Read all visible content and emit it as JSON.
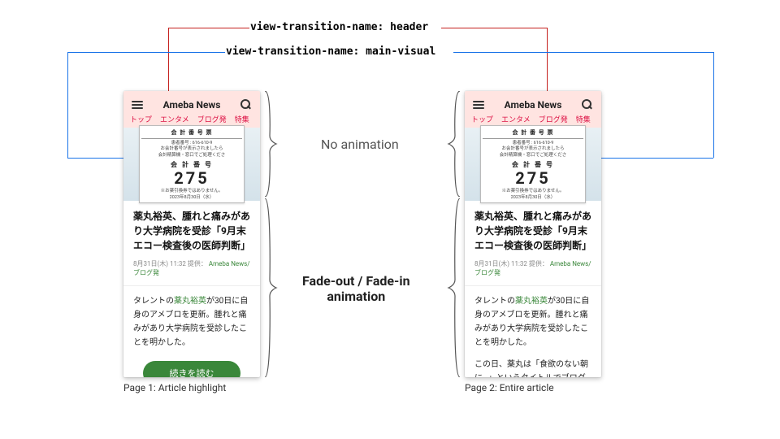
{
  "labels": {
    "header_code": "view-transition-name: header",
    "visual_code": "view-transition-name: main-visual",
    "no_anim": "No animation",
    "fade_anim_line1": "Fade-out / Fade-in",
    "fade_anim_line2": "animation",
    "caption1": "Page 1: Article highlight",
    "caption2": "Page 2: Entire article"
  },
  "phone": {
    "logo": "Ameba News",
    "tabs": [
      "トップ",
      "エンタメ",
      "ブログ発",
      "特集"
    ],
    "receipt": {
      "title": "会 計 番 号 票",
      "line1": "患者番号 : 616-610-9",
      "line2": "お会計番号が表示されましたら",
      "line3": "会計精算機・窓口でご処理くださ",
      "num_label": "会 計 番 号",
      "number": "275",
      "note": "※お薬引換券ではありません。",
      "date": "2023年8月30日（水）"
    },
    "article": {
      "title": "薬丸裕英、腫れと痛みがあり大学病院を受診「9月末エコー検査後の医師判断」",
      "meta_time": "8月31日(木) 11:32",
      "meta_label": "提供：",
      "meta_source": "Ameba News/ブログ発",
      "excerpt_pre": "タレントの",
      "excerpt_hl": "薬丸裕英",
      "excerpt_post": "が30日に自身のアメブロを更新。腫れと痛みがあり大学病院を受診したことを明かした。",
      "btn": "続きを読む",
      "p2_extra": "この日、薬丸は「食欲のない朝に…」というタイトルでブログを更新。「本日の朝食」と切り出し。「自"
    }
  }
}
